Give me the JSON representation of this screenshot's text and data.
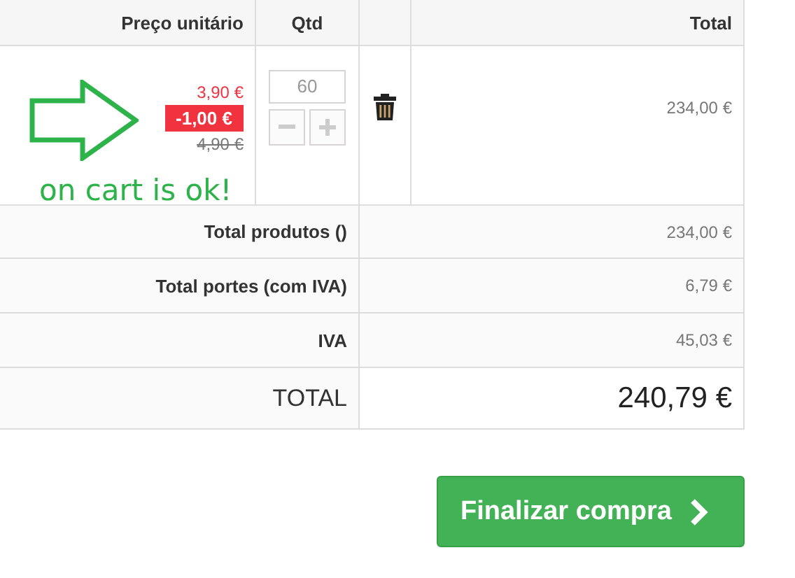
{
  "table": {
    "columns": [
      {
        "label": "Preço unitário"
      },
      {
        "label": "Qtd"
      },
      {
        "label": "Total"
      }
    ],
    "product": {
      "price": "3,90 €",
      "discount": "-1,00 €",
      "old_price": "4,90 €",
      "quantity": "60",
      "total": "234,00 €"
    }
  },
  "annotation": {
    "text": "on cart is ok!"
  },
  "summary": [
    {
      "label": "Total produtos ()",
      "value": "234,00 €",
      "kind": "normal"
    },
    {
      "label": "Total portes (com IVA)",
      "value": "6,79 €",
      "kind": "normal"
    },
    {
      "label": "IVA",
      "value": "45,03 €",
      "kind": "normal"
    },
    {
      "label": "TOTAL",
      "value": "240,79 €",
      "kind": "grand"
    }
  ],
  "checkout_button": {
    "label": "Finalizar compra"
  }
}
